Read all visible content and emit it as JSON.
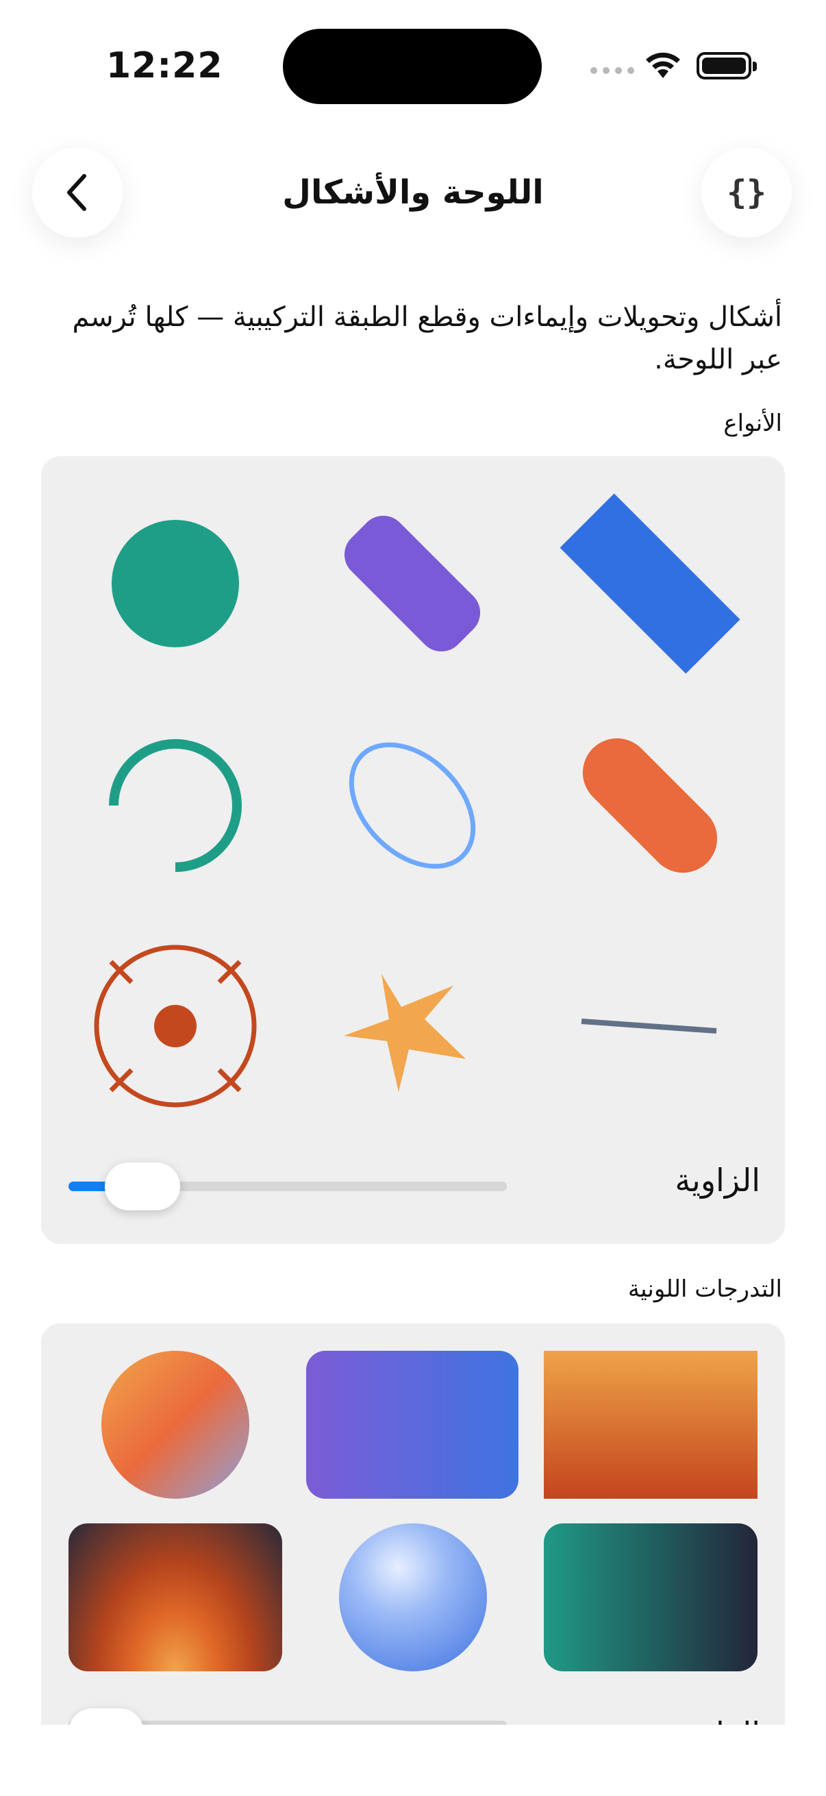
{
  "status_bar": {
    "time": "12:22",
    "battery_level": 1.0
  },
  "nav": {
    "title": "اللوحة والأشكال",
    "back_icon": "chevron-left-icon",
    "code_icon_text": "{}"
  },
  "description": "أشكال وتحويلات وإيماءات وقطع الطبقة التركيبية — كلها تُرسم عبر اللوحة.",
  "sections": {
    "types": {
      "label": "الأنواع",
      "shapes": [
        {
          "name": "circle",
          "color": "#1f9e87"
        },
        {
          "name": "rounded-rectangle",
          "color": "#7a5ad6"
        },
        {
          "name": "rectangle",
          "color": "#3170e0"
        },
        {
          "name": "arc",
          "color": "#1f9e87"
        },
        {
          "name": "ellipse-outline",
          "color": "#6ea8ff"
        },
        {
          "name": "capsule",
          "color": "#e96a3c"
        },
        {
          "name": "target",
          "color": "#c4481e"
        },
        {
          "name": "star",
          "color": "#f2a64e"
        },
        {
          "name": "line",
          "color": "#607087"
        }
      ],
      "slider": {
        "label": "الزاوية",
        "value": 0.1
      }
    },
    "gradients": {
      "label": "التدرجات اللونية",
      "slider": {
        "label": "الزاوية",
        "value": 0.0
      }
    }
  },
  "colors": {
    "accent": "#1280f5",
    "card_background": "#efefef"
  }
}
